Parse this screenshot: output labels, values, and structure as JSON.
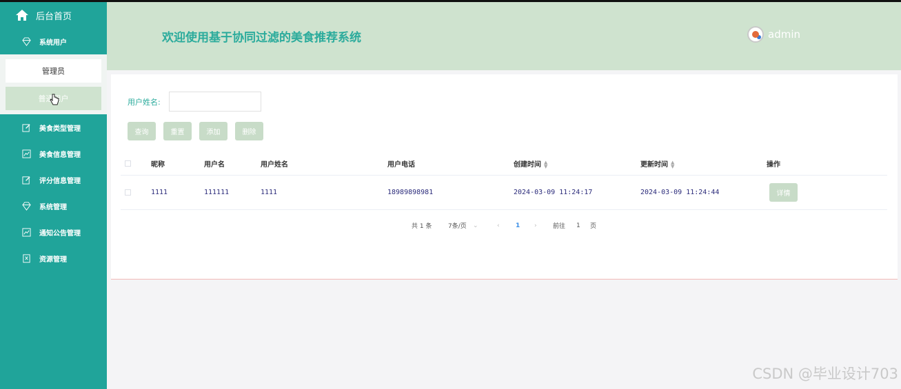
{
  "sidebar": {
    "home_label": "后台首页",
    "items": [
      {
        "label": "系统用户",
        "icon": "diamond-icon"
      },
      {
        "label": "美食类型管理",
        "icon": "edit-icon"
      },
      {
        "label": "美食信息管理",
        "icon": "chart-icon"
      },
      {
        "label": "评分信息管理",
        "icon": "edit-icon"
      },
      {
        "label": "系统管理",
        "icon": "diamond-icon"
      },
      {
        "label": "通知公告管理",
        "icon": "chart-icon"
      },
      {
        "label": "资源管理",
        "icon": "resource-icon"
      }
    ],
    "submenu": [
      {
        "label": "管理员"
      },
      {
        "label": "普通用户"
      }
    ]
  },
  "header": {
    "title": "欢迎使用基于协同过滤的美食推荐系统",
    "username": "admin"
  },
  "search": {
    "label": "用户姓名:",
    "value": ""
  },
  "buttons": {
    "query": "查询",
    "reset": "重置",
    "add": "添加",
    "delete": "删除"
  },
  "table": {
    "columns": [
      "昵称",
      "用户名",
      "用户姓名",
      "用户电话",
      "创建时间",
      "更新时间",
      "操作"
    ],
    "rows": [
      {
        "nickname": "1111",
        "username": "111111",
        "realname": "1111",
        "phone": "18989898981",
        "created": "2024-03-09 11:24:17",
        "updated": "2024-03-09 11:24:44",
        "action": "详情"
      }
    ]
  },
  "pagination": {
    "total": "共 1 条",
    "page_size": "7条/页",
    "current_page": "1",
    "goto_label": "前往",
    "goto_value": "1",
    "page_unit": "页"
  },
  "watermark": "CSDN @毕业设计703",
  "colors": {
    "sidebar": "#20a49a",
    "header": "#cfe3cf",
    "title": "#2bab9c",
    "button": "#c8dcc8"
  }
}
